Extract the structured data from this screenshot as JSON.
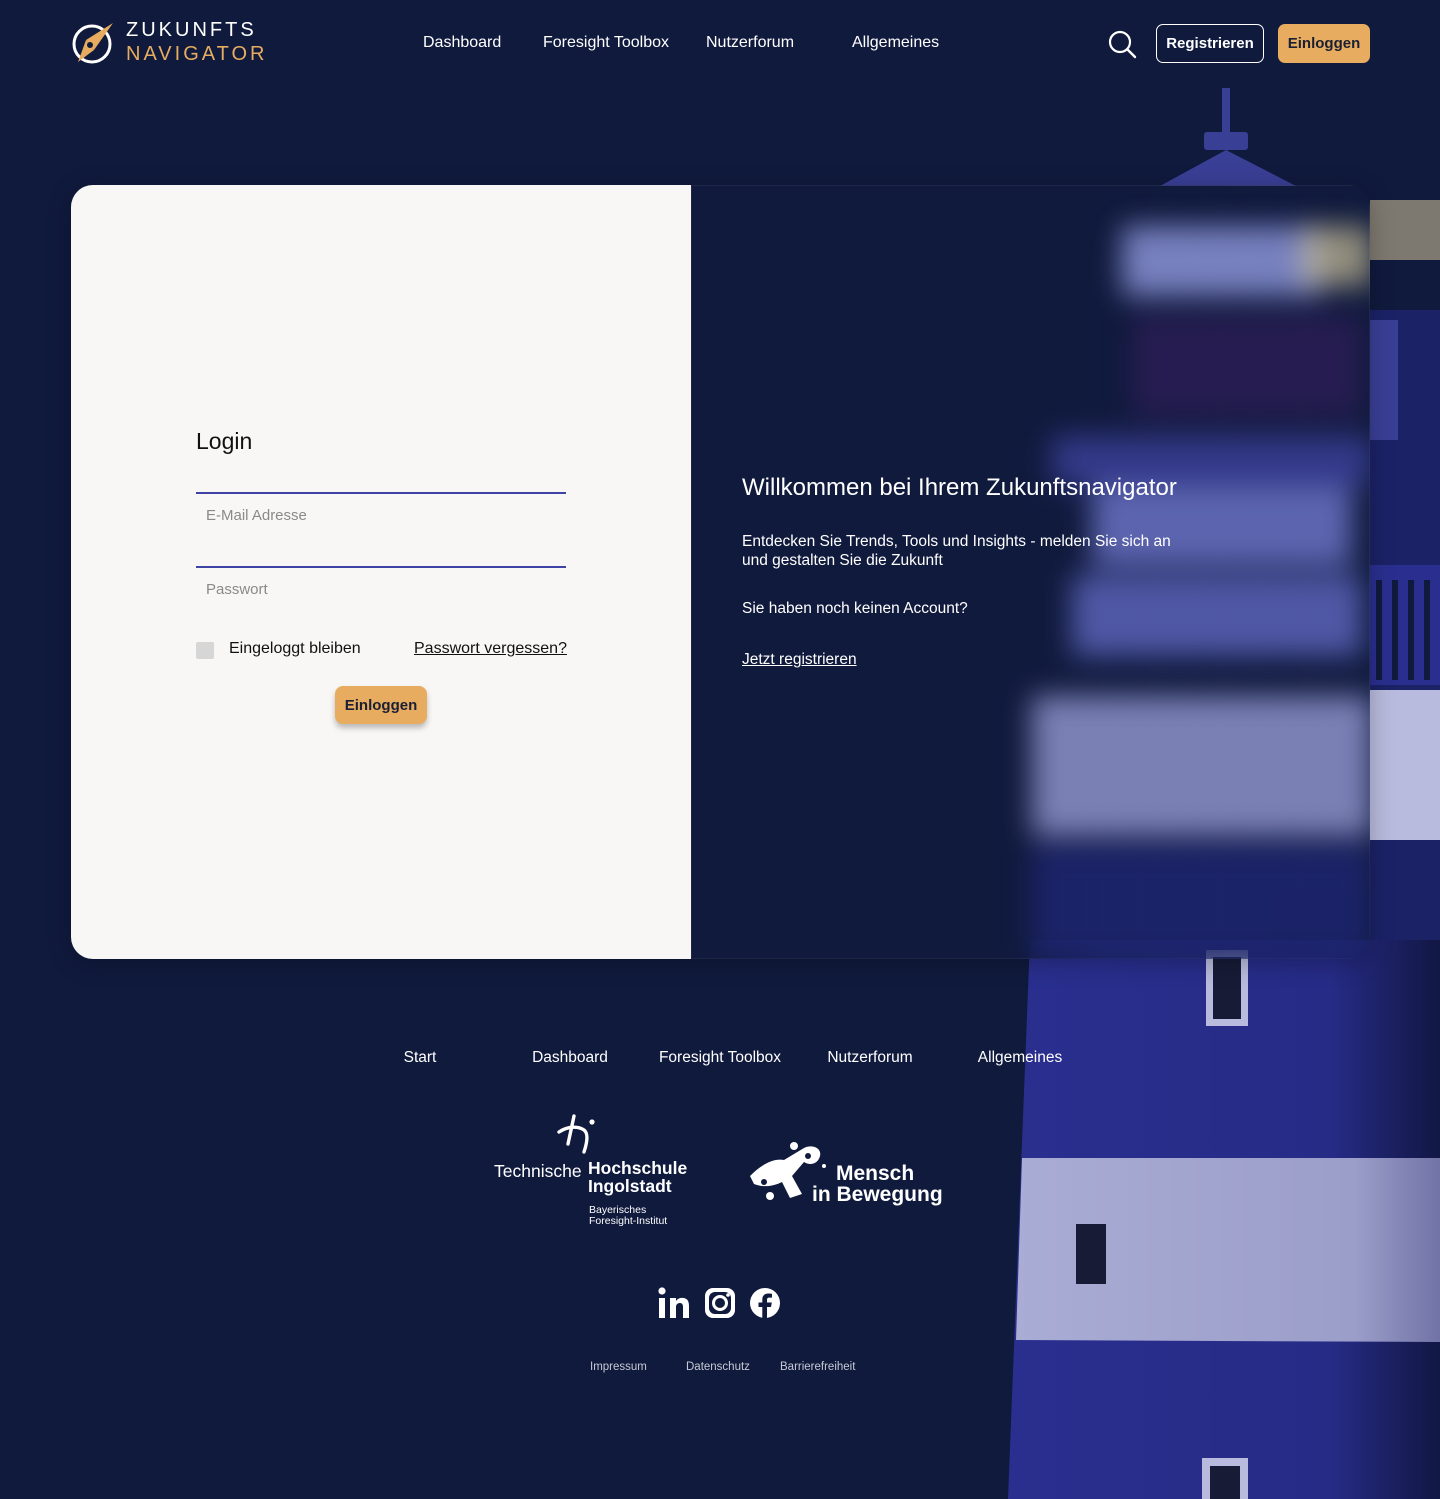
{
  "header": {
    "logo_line1": "ZUKUNFTS",
    "logo_line2": "NAVIGATOR",
    "nav": [
      {
        "label": "Dashboard"
      },
      {
        "label": "Foresight Toolbox"
      },
      {
        "label": "Nutzerforum"
      },
      {
        "label": "Allgemeines"
      }
    ],
    "search_icon": "search-icon",
    "register_label": "Registrieren",
    "login_label": "Einloggen"
  },
  "login": {
    "title": "Login",
    "email_placeholder": "E-Mail Adresse",
    "password_placeholder": "Passwort",
    "remember_label": "Eingeloggt bleiben",
    "forgot_label": "Passwort vergessen?",
    "submit_label": "Einloggen"
  },
  "welcome": {
    "title": "Willkommen bei Ihrem Zukunftsnavigator",
    "text": "Entdecken Sie Trends, Tools und Insights - melden Sie sich an und gestalten Sie die Zukunft",
    "no_account": "Sie haben noch keinen Account?",
    "register_link": "Jetzt registrieren"
  },
  "footer": {
    "nav": [
      {
        "label": "Start"
      },
      {
        "label": "Dashboard"
      },
      {
        "label": "Foresight Toolbox"
      },
      {
        "label": "Nutzerforum"
      },
      {
        "label": "Allgemeines"
      }
    ],
    "thi": {
      "line1": "Technische",
      "line2a": "Hochschule",
      "line2b": "Ingolstadt",
      "line3a": "Bayerisches",
      "line3b": "Foresight-Institut"
    },
    "mib": {
      "line1": "Mensch",
      "line2": "in Bewegung"
    },
    "social": [
      "linkedin-icon",
      "instagram-icon",
      "facebook-icon"
    ],
    "legal": [
      {
        "label": "Impressum"
      },
      {
        "label": "Datenschutz"
      },
      {
        "label": "Barrierefreiheit"
      }
    ]
  },
  "colors": {
    "background": "#101a3d",
    "accent": "#e7ac5f",
    "card": "#f8f7f5",
    "input_line": "#3f43a6",
    "lighthouse_blue": "#2a2f8f",
    "lighthouse_white": "#b8bbdd"
  }
}
